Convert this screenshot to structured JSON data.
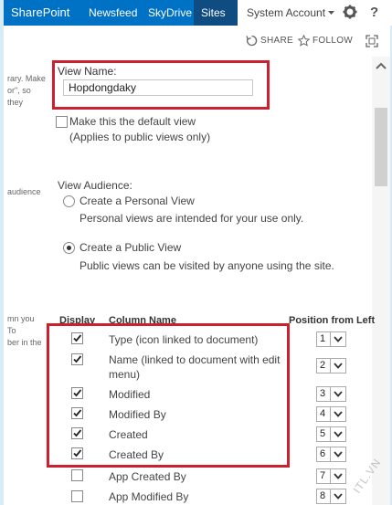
{
  "suite_bar": {
    "brand": "SharePoint",
    "links": [
      "Newsfeed",
      "SkyDrive",
      "Sites"
    ],
    "user": "System Account",
    "help": "?"
  },
  "actions": {
    "share": "SHARE",
    "follow": "FOLLOW"
  },
  "left_descriptions": {
    "line1": "rary. Make",
    "line2": "or\", so",
    "line3": "they",
    "line4": "audience",
    "line5": "mn you",
    "line6": "To",
    "line7": "ber in the"
  },
  "view_name": {
    "label": "View Name:",
    "value": "Hopdongdaky"
  },
  "default_view": {
    "label": "Make this the default view",
    "note": "(Applies to public views only)",
    "checked": false
  },
  "audience": {
    "label": "View Audience:",
    "options": [
      {
        "label": "Create a Personal View",
        "note": "Personal views are intended for your use only.",
        "selected": false
      },
      {
        "label": "Create a Public View",
        "note": "Public views can be visited by anyone using the site.",
        "selected": true
      }
    ]
  },
  "columns_table": {
    "headers": {
      "display": "Display",
      "name": "Column Name",
      "position": "Position from Left"
    },
    "rows": [
      {
        "name_line1": "Type (icon linked to document)",
        "name_line2": "",
        "checked": true,
        "position": "1"
      },
      {
        "name_line1": "Name (linked to document with edit",
        "name_line2": "menu)",
        "checked": true,
        "position": "2"
      },
      {
        "name_line1": "Modified",
        "name_line2": "",
        "checked": true,
        "position": "3"
      },
      {
        "name_line1": "Modified By",
        "name_line2": "",
        "checked": true,
        "position": "4"
      },
      {
        "name_line1": "Created",
        "name_line2": "",
        "checked": true,
        "position": "5"
      },
      {
        "name_line1": "Created By",
        "name_line2": "",
        "checked": true,
        "position": "6"
      },
      {
        "name_line1": "App Created By",
        "name_line2": "",
        "checked": false,
        "position": "7"
      },
      {
        "name_line1": "App Modified By",
        "name_line2": "",
        "checked": false,
        "position": "8"
      }
    ]
  },
  "watermark": "ITL.VN",
  "colors": {
    "suite_bar": "#0072c6",
    "active_tab": "#0f4c81",
    "highlight_box": "#cc1f2f",
    "frame": "#d8ecf8"
  }
}
